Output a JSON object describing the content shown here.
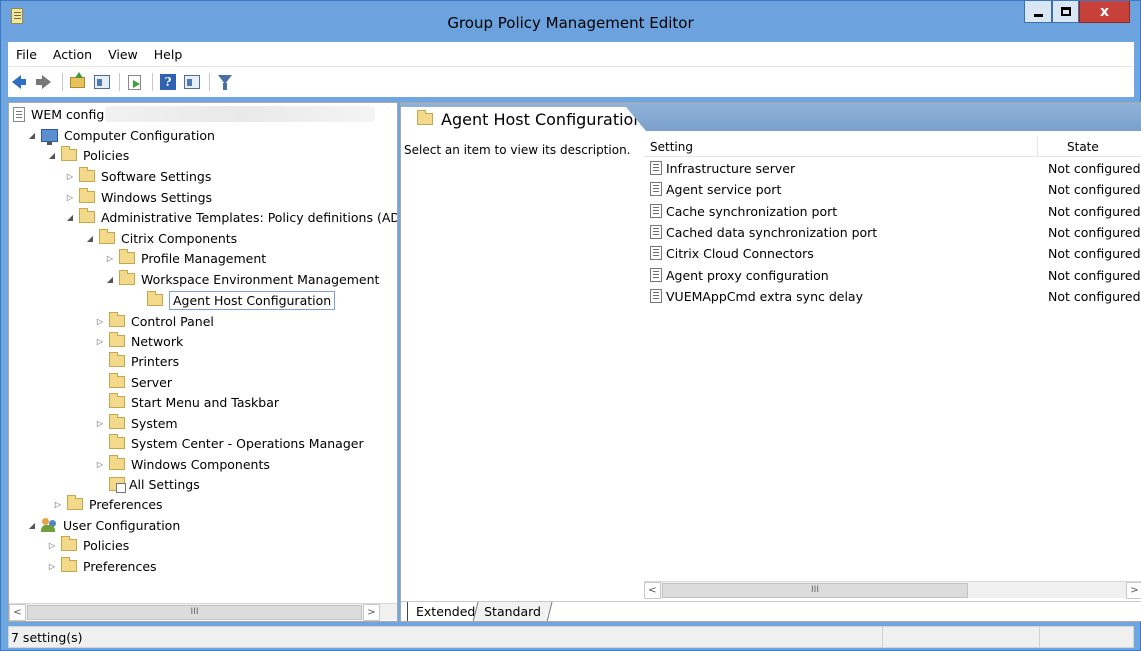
{
  "window": {
    "title": "Group Policy Management Editor",
    "close_glyph": "x"
  },
  "menu": [
    "File",
    "Action",
    "View",
    "Help"
  ],
  "toolbar": {
    "icons": [
      "back-arrow-icon",
      "forward-arrow-icon",
      "up-folder-icon",
      "show-hide-tree-icon",
      "export-list-icon",
      "help-icon",
      "show-pane-icon",
      "filter-icon"
    ],
    "help_glyph": "?"
  },
  "tree": {
    "root": "WEM config",
    "computer_configuration": "Computer Configuration",
    "policies": "Policies",
    "software_settings": "Software Settings",
    "windows_settings": "Windows Settings",
    "administrative_templates": "Administrative Templates: Policy definitions (AD",
    "citrix_components": "Citrix Components",
    "profile_management": "Profile Management",
    "workspace_environment_management": "Workspace Environment Management",
    "agent_host_configuration": "Agent Host Configuration",
    "control_panel": "Control Panel",
    "network": "Network",
    "printers": "Printers",
    "server": "Server",
    "start_menu_taskbar": "Start Menu and Taskbar",
    "system": "System",
    "system_center": "System Center - Operations Manager",
    "windows_components": "Windows Components",
    "all_settings": "All Settings",
    "preferences": "Preferences",
    "user_configuration": "User Configuration",
    "user_policies": "Policies",
    "user_preferences": "Preferences",
    "expander_expanded": "◢",
    "expander_collapsed": "▷"
  },
  "details": {
    "header": "Agent Host Configuration",
    "description": "Select an item to view its description.",
    "columns": {
      "setting": "Setting",
      "state": "State"
    },
    "rows": [
      {
        "name": "Infrastructure server",
        "state": "Not configured"
      },
      {
        "name": "Agent service port",
        "state": "Not configured"
      },
      {
        "name": "Cache synchronization port",
        "state": "Not configured"
      },
      {
        "name": "Cached data synchronization port",
        "state": "Not configured"
      },
      {
        "name": "Citrix Cloud Connectors",
        "state": "Not configured"
      },
      {
        "name": "Agent proxy configuration",
        "state": "Not configured"
      },
      {
        "name": "VUEMAppCmd extra sync delay",
        "state": "Not configured"
      }
    ],
    "tabs": {
      "extended": "Extended",
      "standard": "Standard"
    }
  },
  "scroll": {
    "left": "<",
    "right": ">",
    "thumb": "III"
  },
  "status": {
    "text": "7 setting(s)"
  }
}
